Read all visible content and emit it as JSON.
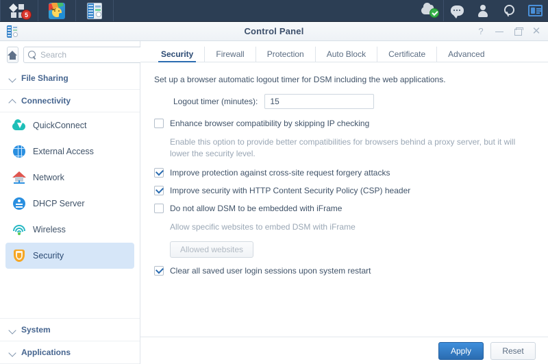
{
  "taskbar": {
    "left_items": [
      {
        "name": "main-menu",
        "icon": "tiles-icon",
        "badge": "5"
      },
      {
        "name": "photos-app",
        "icon": "photos-icon",
        "badge": ""
      },
      {
        "name": "control-panel-app",
        "icon": "control-panel-icon",
        "badge": ""
      }
    ],
    "right_items": [
      {
        "name": "quickconnect-status",
        "icon": "cloud-check-icon"
      },
      {
        "name": "notifications",
        "icon": "chat-bubble-icon"
      },
      {
        "name": "user-account",
        "icon": "user-icon"
      },
      {
        "name": "search",
        "icon": "search-icon"
      },
      {
        "name": "widgets",
        "icon": "widget-panel-icon"
      }
    ]
  },
  "window": {
    "title": "Control Panel",
    "controls": {
      "help": "?",
      "minimize": "–",
      "maximize": "❐",
      "close": "✕"
    }
  },
  "sidebar": {
    "home_label": "Home",
    "search": {
      "placeholder": "Search",
      "value": ""
    },
    "groups": [
      {
        "label": "File Sharing",
        "expanded": false
      },
      {
        "label": "Connectivity",
        "expanded": true
      },
      {
        "label": "System",
        "expanded": false
      },
      {
        "label": "Applications",
        "expanded": false
      }
    ],
    "items": [
      {
        "label": "QuickConnect",
        "icon": "quickconnect-icon",
        "selected": false
      },
      {
        "label": "External Access",
        "icon": "globe-icon",
        "selected": false
      },
      {
        "label": "Network",
        "icon": "network-house-icon",
        "selected": false
      },
      {
        "label": "DHCP Server",
        "icon": "dhcp-icon",
        "selected": false
      },
      {
        "label": "Wireless",
        "icon": "wireless-icon",
        "selected": false
      },
      {
        "label": "Security",
        "icon": "shield-icon",
        "selected": true
      }
    ]
  },
  "tabs": [
    {
      "label": "Security",
      "active": true
    },
    {
      "label": "Firewall",
      "active": false
    },
    {
      "label": "Protection",
      "active": false
    },
    {
      "label": "Auto Block",
      "active": false
    },
    {
      "label": "Certificate",
      "active": false
    },
    {
      "label": "Advanced",
      "active": false
    }
  ],
  "panel": {
    "description": "Set up a browser automatic logout timer for DSM including the web applications.",
    "logout_timer": {
      "label": "Logout timer (minutes):",
      "value": "15"
    },
    "options": [
      {
        "label": "Enhance browser compatibility by skipping IP checking",
        "checked": false,
        "hint": "Enable this option to provide better compatibilities for browsers behind a proxy server, but it will lower the security level."
      },
      {
        "label": "Improve protection against cross-site request forgery attacks",
        "checked": true,
        "hint": ""
      },
      {
        "label": "Improve security with HTTP Content Security Policy (CSP) header",
        "checked": true,
        "hint": ""
      },
      {
        "label": "Do not allow DSM to be embedded with iFrame",
        "checked": false,
        "hint": "Allow specific websites to embed DSM with iFrame"
      },
      {
        "label": "Clear all saved user login sessions upon system restart",
        "checked": true,
        "hint": ""
      }
    ],
    "allowed_websites_button": "Allowed websites"
  },
  "footer": {
    "apply_label": "Apply",
    "reset_label": "Reset"
  },
  "colors": {
    "taskbar_bg": "#2c3e54",
    "accent": "#2b6cb0",
    "selected_item_bg": "#d6e6f8",
    "badge_red": "#d9352c",
    "shield_orange": "#f5a623",
    "quickconnect_teal": "#1fbfb8"
  }
}
